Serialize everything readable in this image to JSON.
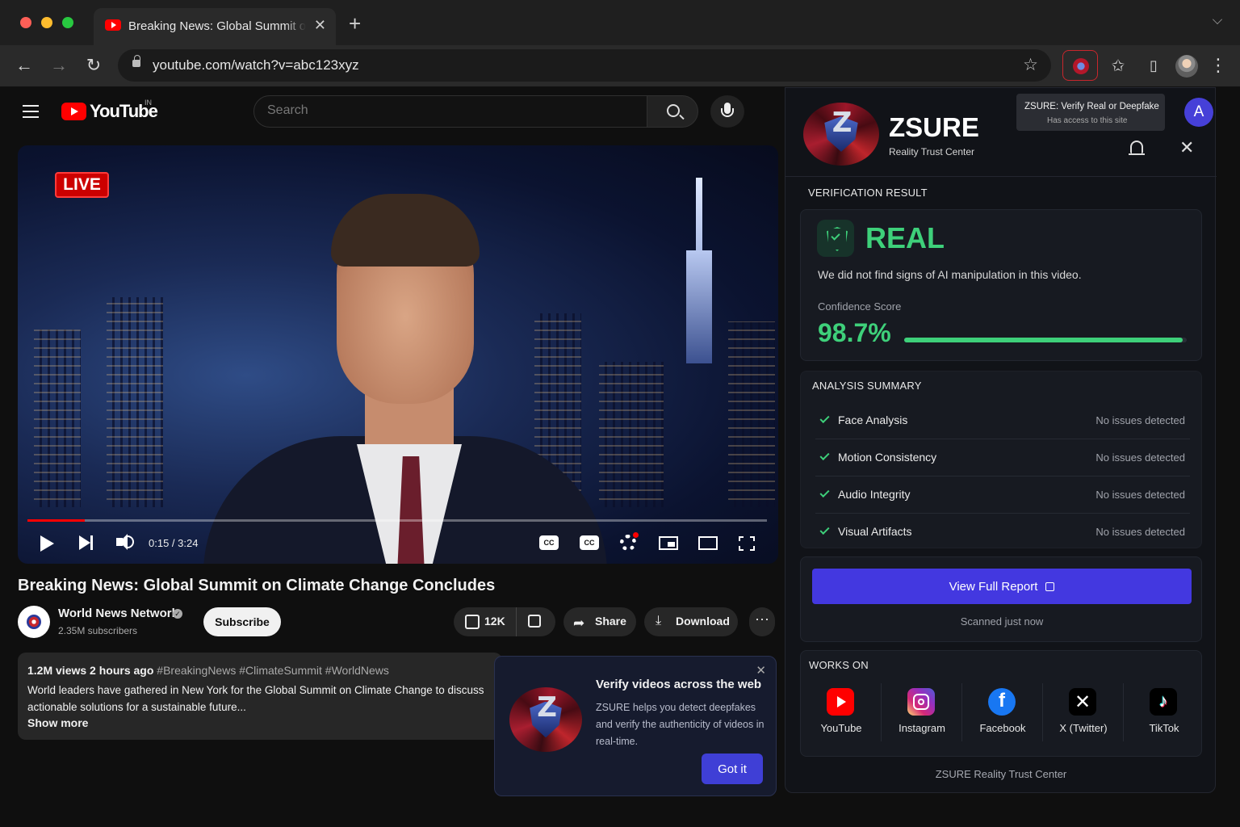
{
  "browser": {
    "tab_title": "Breaking News: Global Summit on Climate Change Concludes - YouTube",
    "url": "youtube.com/watch?v=abc123xyz",
    "traffic_colors": [
      "#ff5f57",
      "#febc2e",
      "#28c840"
    ]
  },
  "youtube": {
    "logo_text": "YouTube",
    "region": "IN",
    "search_placeholder": "Search",
    "video": {
      "live_label": "LIVE",
      "time": "0:15 / 3:24",
      "progress": 0.077,
      "cc_label": "CC"
    },
    "title": "Breaking News: Global Summit on Climate Change Concludes",
    "channel": {
      "name": "World News Network",
      "subscribers": "2.35M subscribers",
      "subscribe_label": "Subscribe"
    },
    "actions": {
      "likes": "12K",
      "share": "Share",
      "download": "Download",
      "more": "···"
    },
    "description": {
      "meta": "1.2M views  2 hours ago",
      "tags": "#BreakingNews #ClimateSummit #WorldNews",
      "text": "World leaders have gathered in New York for the Global Summit on Climate Change to discuss actionable solutions for a sustainable future...",
      "show_more": "Show more"
    }
  },
  "onboarding": {
    "title": "Verify videos across the web",
    "text": "ZSURE helps you detect deepfakes and verify the authenticity of videos in real-time.",
    "button": "Got it"
  },
  "zsure": {
    "brand": "ZSURE",
    "subtitle": "Reality Trust Center",
    "tooltip_title": "ZSURE: Verify Real or Deepfake",
    "tooltip_sub": "Has access to this site",
    "avatar_letter": "A",
    "verification_label": "VERIFICATION RESULT",
    "verdict": "REAL",
    "verdict_text": "We did not find signs of AI manipulation in this video.",
    "confidence_label": "Confidence Score",
    "confidence_value": "98.7%",
    "confidence_fraction": 0.987,
    "analysis_label": "ANALYSIS SUMMARY",
    "analysis": [
      {
        "name": "Face Analysis",
        "status": "No issues detected"
      },
      {
        "name": "Motion Consistency",
        "status": "No issues detected"
      },
      {
        "name": "Audio Integrity",
        "status": "No issues detected"
      },
      {
        "name": "Visual Artifacts",
        "status": "No issues detected"
      }
    ],
    "report_button": "View Full Report",
    "scanned": "Scanned just now",
    "works_on_label": "WORKS ON",
    "platforms": [
      {
        "name": "YouTube",
        "icon": "youtube-icon",
        "color": "#ff0000"
      },
      {
        "name": "Instagram",
        "icon": "instagram-icon",
        "color": "#d6249f"
      },
      {
        "name": "Facebook",
        "icon": "facebook-icon",
        "color": "#1877f2"
      },
      {
        "name": "X (Twitter)",
        "icon": "x-icon",
        "color": "#000000"
      },
      {
        "name": "TikTok",
        "icon": "tiktok-icon",
        "color": "#000000"
      }
    ],
    "footer": "ZSURE Reality Trust Center",
    "accent": "#4338e0",
    "success": "#3ed07a"
  }
}
